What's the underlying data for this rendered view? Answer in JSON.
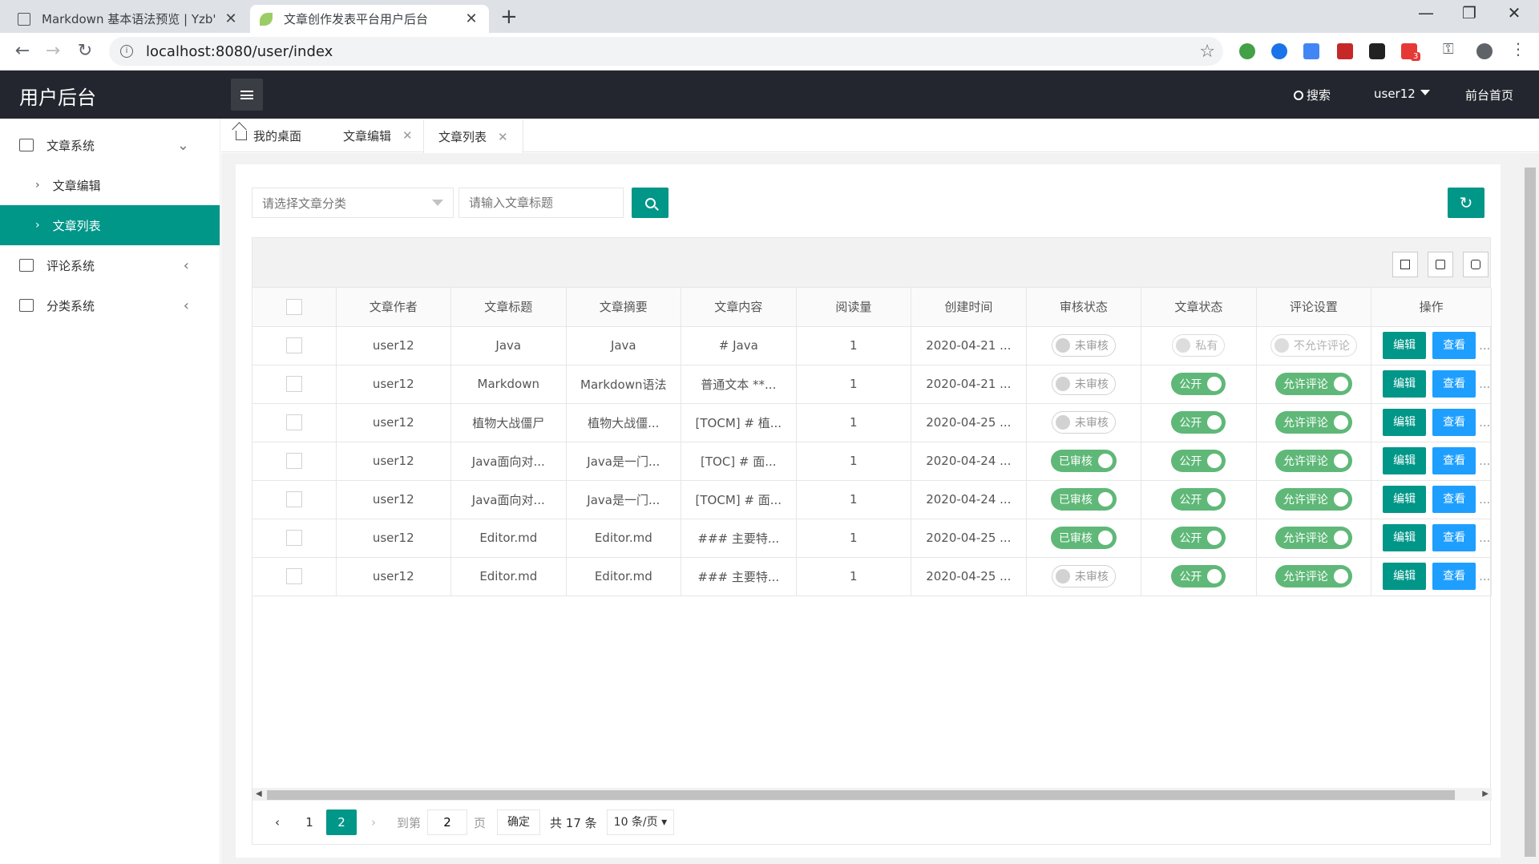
{
  "browser": {
    "tabs": [
      {
        "title": "Markdown 基本语法预览 | Yzb'",
        "active": false
      },
      {
        "title": "文章创作发表平台用户后台",
        "active": true
      }
    ],
    "url": "localhost:8080/user/index",
    "badge_count": "3"
  },
  "header": {
    "title": "用户后台",
    "search_label": "搜索",
    "user_label": "user12",
    "front_label": "前台首页"
  },
  "sidebar": {
    "groups": [
      {
        "label": "文章系统",
        "expanded": true,
        "children": [
          {
            "label": "文章编辑",
            "active": false
          },
          {
            "label": "文章列表",
            "active": true
          }
        ]
      },
      {
        "label": "评论系统",
        "expanded": false
      },
      {
        "label": "分类系统",
        "expanded": false
      }
    ]
  },
  "content_tabs": [
    {
      "label": "我的桌面"
    },
    {
      "label": "文章编辑"
    },
    {
      "label": "文章列表"
    }
  ],
  "filters": {
    "category_placeholder": "请选择文章分类",
    "title_placeholder": "请输入文章标题"
  },
  "table": {
    "columns": [
      "文章作者",
      "文章标题",
      "文章摘要",
      "文章内容",
      "阅读量",
      "创建时间",
      "审核状态",
      "文章状态",
      "评论设置",
      "操作"
    ],
    "rows": [
      {
        "author": "user12",
        "title": "Java",
        "summary": "Java",
        "content": "# Java",
        "reads": "1",
        "created": "2020-04-21 ...",
        "audit": "未审核",
        "audit_on": false,
        "status": "私有",
        "status_on": false,
        "comment": "不允许评论",
        "comment_on": false
      },
      {
        "author": "user12",
        "title": "Markdown",
        "summary": "Markdown语法",
        "content": "普通文本 **...",
        "reads": "1",
        "created": "2020-04-21 ...",
        "audit": "未审核",
        "audit_on": false,
        "status": "公开",
        "status_on": true,
        "comment": "允许评论",
        "comment_on": true
      },
      {
        "author": "user12",
        "title": "植物大战僵尸",
        "summary": "植物大战僵...",
        "content": "[TOCM] # 植...",
        "reads": "1",
        "created": "2020-04-25 ...",
        "audit": "未审核",
        "audit_on": false,
        "status": "公开",
        "status_on": true,
        "comment": "允许评论",
        "comment_on": true
      },
      {
        "author": "user12",
        "title": "Java面向对...",
        "summary": "Java是一门...",
        "content": "[TOC] # 面...",
        "reads": "1",
        "created": "2020-04-24 ...",
        "audit": "已审核",
        "audit_on": true,
        "status": "公开",
        "status_on": true,
        "comment": "允许评论",
        "comment_on": true
      },
      {
        "author": "user12",
        "title": "Java面向对...",
        "summary": "Java是一门...",
        "content": "[TOCM] # 面...",
        "reads": "1",
        "created": "2020-04-24 ...",
        "audit": "已审核",
        "audit_on": true,
        "status": "公开",
        "status_on": true,
        "comment": "允许评论",
        "comment_on": true
      },
      {
        "author": "user12",
        "title": "Editor.md",
        "summary": "Editor.md",
        "content": "### 主要特...",
        "reads": "1",
        "created": "2020-04-25 ...",
        "audit": "已审核",
        "audit_on": true,
        "status": "公开",
        "status_on": true,
        "comment": "允许评论",
        "comment_on": true
      },
      {
        "author": "user12",
        "title": "Editor.md",
        "summary": "Editor.md",
        "content": "### 主要特...",
        "reads": "1",
        "created": "2020-04-25 ...",
        "audit": "未审核",
        "audit_on": false,
        "status": "公开",
        "status_on": true,
        "comment": "允许评论",
        "comment_on": true
      }
    ],
    "edit_label": "编辑",
    "view_label": "查看",
    "more_label": "..."
  },
  "pagination": {
    "pages": [
      "1",
      "2"
    ],
    "current": "2",
    "goto_label": "到第",
    "goto_value": "2",
    "page_unit": "页",
    "confirm_label": "确定",
    "total_label": "共 17 条",
    "page_size": "10 条/页"
  },
  "colors": {
    "primary": "#009688",
    "view": "#1e9fff",
    "switch_on": "#5fb878",
    "header_bg": "#23262e"
  }
}
